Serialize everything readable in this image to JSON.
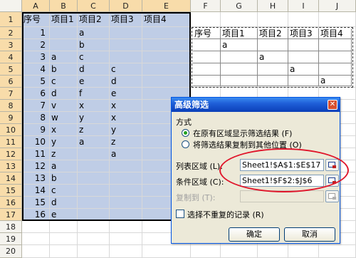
{
  "columns": [
    "A",
    "B",
    "C",
    "D",
    "E",
    "F",
    "G",
    "H",
    "I",
    "J"
  ],
  "rows": [
    "1",
    "2",
    "3",
    "4",
    "5",
    "6",
    "7",
    "8",
    "9",
    "10",
    "11",
    "12",
    "13",
    "14",
    "15",
    "16",
    "17",
    "18",
    "19",
    "20"
  ],
  "sheet": {
    "A": [
      "序号",
      "1",
      "2",
      "3",
      "4",
      "5",
      "6",
      "7",
      "8",
      "9",
      "10",
      "11",
      "12",
      "13",
      "14",
      "15",
      "16"
    ],
    "B": [
      "项目1",
      "",
      "",
      "a",
      "b",
      "c",
      "d",
      "v",
      "w",
      "x",
      "y",
      "z",
      "a",
      "b",
      "c",
      "d",
      "e"
    ],
    "C": [
      "项目2",
      "a",
      "b",
      "c",
      "d",
      "e",
      "f",
      "x",
      "y",
      "z",
      "a",
      "",
      "",
      "",
      "",
      "",
      ""
    ],
    "D": [
      "项目3",
      "",
      "",
      "",
      "c",
      "d",
      "e",
      "x",
      "x",
      "y",
      "z",
      "a",
      "",
      "",
      "",
      "",
      ""
    ],
    "E": [
      "项目4",
      "",
      "",
      "",
      "",
      "",
      "",
      "",
      "",
      "",
      "",
      "",
      "",
      "",
      "",
      "",
      ""
    ]
  },
  "criteria": {
    "headers": [
      "序号",
      "项目1",
      "项目2",
      "项目3",
      "项目4"
    ],
    "rows": [
      [
        "",
        "a",
        "",
        "",
        ""
      ],
      [
        "",
        "",
        "a",
        "",
        ""
      ],
      [
        "",
        "",
        "",
        "a",
        ""
      ],
      [
        "",
        "",
        "",
        "",
        "a"
      ]
    ]
  },
  "dialog": {
    "title": "高级筛选",
    "close": "✕",
    "section": "方式",
    "option1": "在原有区域显示筛选结果 (F)",
    "option2": "将筛选结果复制到其他位置 (O)",
    "list_label": "列表区域 (L):",
    "list_value": "Sheet1!$A$1:$E$17",
    "criteria_label": "条件区域 (C):",
    "criteria_value": "Sheet1!$F$2:$J$6",
    "copyto_label": "复制到 (T):",
    "copyto_value": "",
    "unique_label": "选择不重复的记录 (R)",
    "ok": "确定",
    "cancel": "取消"
  },
  "colors": {
    "selection": "#bfcde6",
    "highlight": "#e0162b",
    "title_bar": "#0a3fb8"
  }
}
